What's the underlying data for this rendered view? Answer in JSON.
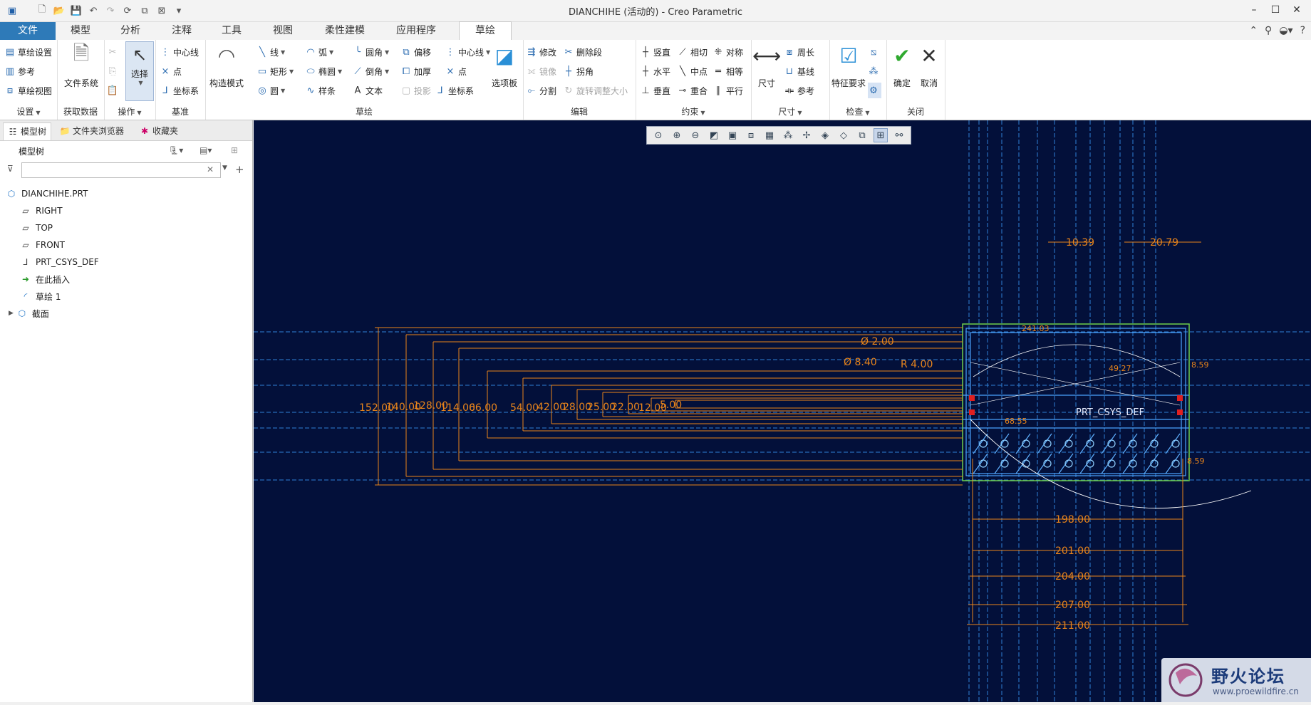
{
  "window": {
    "title": "DIANCHIHE (活动的) - Creo Parametric"
  },
  "tabs": [
    {
      "label": "文件"
    },
    {
      "label": "模型"
    },
    {
      "label": "分析"
    },
    {
      "label": "注释"
    },
    {
      "label": "工具"
    },
    {
      "label": "视图"
    },
    {
      "label": "柔性建模"
    },
    {
      "label": "应用程序"
    },
    {
      "label": "草绘"
    }
  ],
  "ribbon": {
    "setup": {
      "label": "设置",
      "items": [
        "草绘设置",
        "参考",
        "草绘视图"
      ]
    },
    "getdata": {
      "label": "获取数据",
      "filesystem": "文件系统"
    },
    "ops": {
      "label": "操作",
      "select": "选择"
    },
    "datum": {
      "label": "基准",
      "items": [
        "中心线",
        "点",
        "坐标系"
      ]
    },
    "sketch": {
      "label": "草绘",
      "construct": "构造模式",
      "col1": [
        "线",
        "矩形",
        "圆"
      ],
      "col2": [
        "弧",
        "椭圆",
        "样条"
      ],
      "col3": [
        "圆角",
        "倒角",
        "文本"
      ],
      "col4": [
        "偏移",
        "加厚",
        "投影"
      ],
      "col5": [
        "中心线",
        "点",
        "坐标系"
      ],
      "palette": "选项板"
    },
    "edit": {
      "label": "编辑",
      "items": [
        "修改",
        "删除段",
        "镜像",
        "拐角",
        "分割",
        "旋转调整大小"
      ]
    },
    "constrain": {
      "label": "约束",
      "items": [
        "竖直",
        "相切",
        "对称",
        "水平",
        "中点",
        "相等",
        "垂直",
        "重合",
        "平行"
      ]
    },
    "dimension": {
      "label": "尺寸",
      "dim": "尺寸",
      "items": [
        "周长",
        "基线",
        "参考"
      ]
    },
    "inspect": {
      "label": "检查",
      "feature": "特征要求"
    },
    "close": {
      "label": "关闭",
      "ok": "确定",
      "cancel": "取消"
    }
  },
  "panel": {
    "tabs": [
      "模型树",
      "文件夹浏览器",
      "收藏夹"
    ],
    "tree_title": "模型树",
    "filter_placeholder": "",
    "items": [
      {
        "label": "DIANCHIHE.PRT",
        "icon": "part-icon"
      },
      {
        "label": "RIGHT",
        "icon": "plane-icon"
      },
      {
        "label": "TOP",
        "icon": "plane-icon"
      },
      {
        "label": "FRONT",
        "icon": "plane-icon"
      },
      {
        "label": "PRT_CSYS_DEF",
        "icon": "csys-icon"
      },
      {
        "label": "在此插入",
        "icon": "insert-arrow-icon"
      },
      {
        "label": "草绘 1",
        "icon": "sketch-icon"
      },
      {
        "label": "截面",
        "icon": "section-icon"
      }
    ]
  },
  "sketch": {
    "vertical_dims": [
      "152.00",
      "140.00",
      "128.00",
      "114.00",
      "66.00",
      "54.00",
      "42.00",
      "28.00",
      "25.00",
      "22.00",
      "12.00",
      "5.00"
    ],
    "horizontal_dims": [
      "198.00",
      "201.00",
      "204.00",
      "207.00",
      "211.00"
    ],
    "top_dims": [
      "10.39",
      "20.79"
    ],
    "diameters": [
      "Ø 2.00",
      "Ø 8.40"
    ],
    "radius": "R 4.00",
    "side_dims": [
      "8.59",
      "8.59"
    ],
    "misc_dims": [
      "241.03",
      "49.27",
      "68.55"
    ],
    "csys_label": "PRT_CSYS_DEF"
  },
  "watermark": {
    "title": "野火论坛",
    "url": "www.proewildfire.cn"
  },
  "colors": {
    "canvas": "#03103a",
    "dimension": "#e8841b",
    "geometry": "#4aa3ff",
    "accent": "#2e7ab8"
  }
}
